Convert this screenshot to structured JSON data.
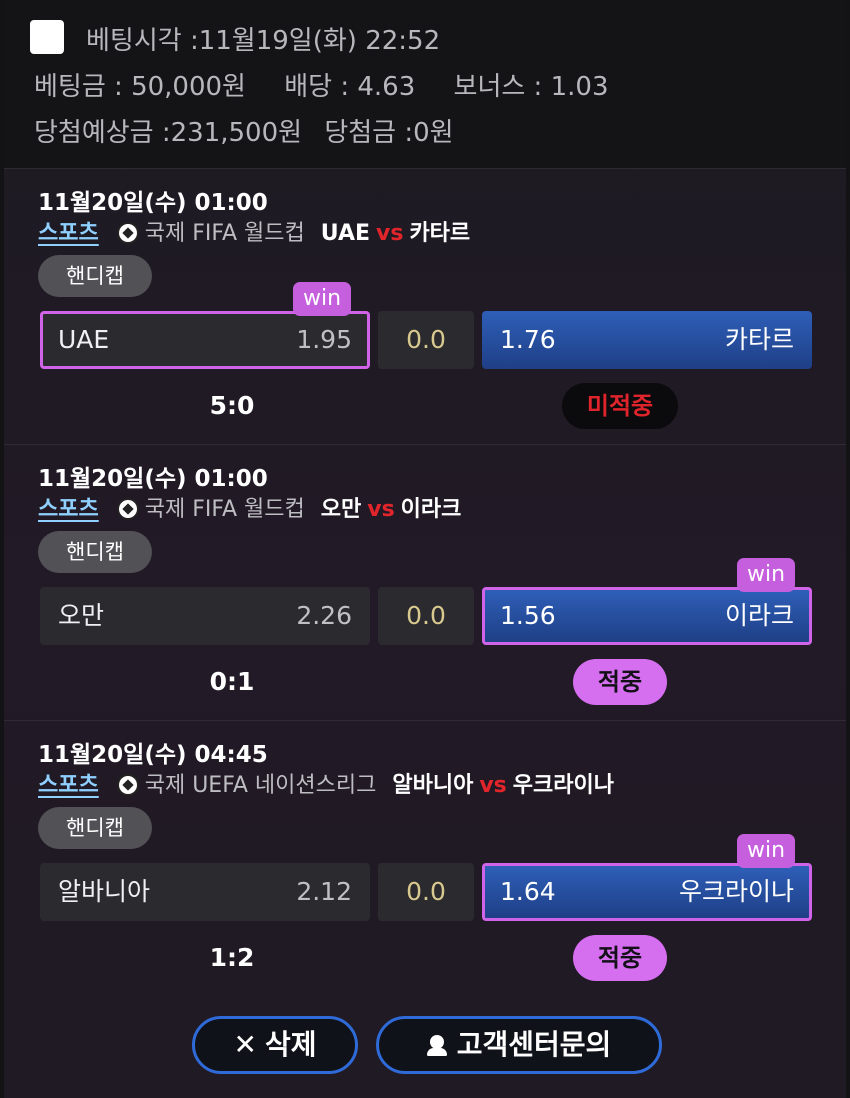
{
  "header": {
    "bet_time_label": "베팅시각 :",
    "bet_time_value": "11월19일(화) 22:52",
    "stake_label": "베팅금 :",
    "stake_value": "50,000원",
    "odds_label": "배당 :",
    "odds_value": "4.63",
    "bonus_label": "보너스 :",
    "bonus_value": "1.03",
    "expected_label": "당첨예상금 :",
    "expected_value": "231,500원",
    "payout_label": "당첨금 :",
    "payout_value": "0원"
  },
  "bets": [
    {
      "time": "11월20일(수) 01:00",
      "sport": "스포츠",
      "league": "국제 FIFA 월드컵",
      "home": "UAE",
      "vs": "vs",
      "away": "카타르",
      "market": "핸디캡",
      "home_odds": "1.95",
      "draw": "0.0",
      "away_odds": "1.76",
      "win_tag": "win",
      "score": "5:0",
      "result": "미적중"
    },
    {
      "time": "11월20일(수) 01:00",
      "sport": "스포츠",
      "league": "국제 FIFA 월드컵",
      "home": "오만",
      "vs": "vs",
      "away": "이라크",
      "market": "핸디캡",
      "home_odds": "2.26",
      "draw": "0.0",
      "away_odds": "1.56",
      "win_tag": "win",
      "score": "0:1",
      "result": "적중"
    },
    {
      "time": "11월20일(수) 04:45",
      "sport": "스포츠",
      "league": "국제 UEFA 네이션스리그",
      "home": "알바니아",
      "vs": "vs",
      "away": "우크라이나",
      "market": "핸디캡",
      "home_odds": "2.12",
      "draw": "0.0",
      "away_odds": "1.64",
      "win_tag": "win",
      "score": "1:2",
      "result": "적중"
    }
  ],
  "footer": {
    "delete_label": "삭제",
    "support_label": "고객센터문의"
  },
  "icons": {
    "close": "close-icon",
    "headset": "headset-icon",
    "soccer": "soccer-ball-icon"
  },
  "colors": {
    "selected_border": "#d064e8",
    "lose_text": "#e0242b",
    "away_button": "#2e5fb8",
    "button_border": "#2f6bd8"
  }
}
